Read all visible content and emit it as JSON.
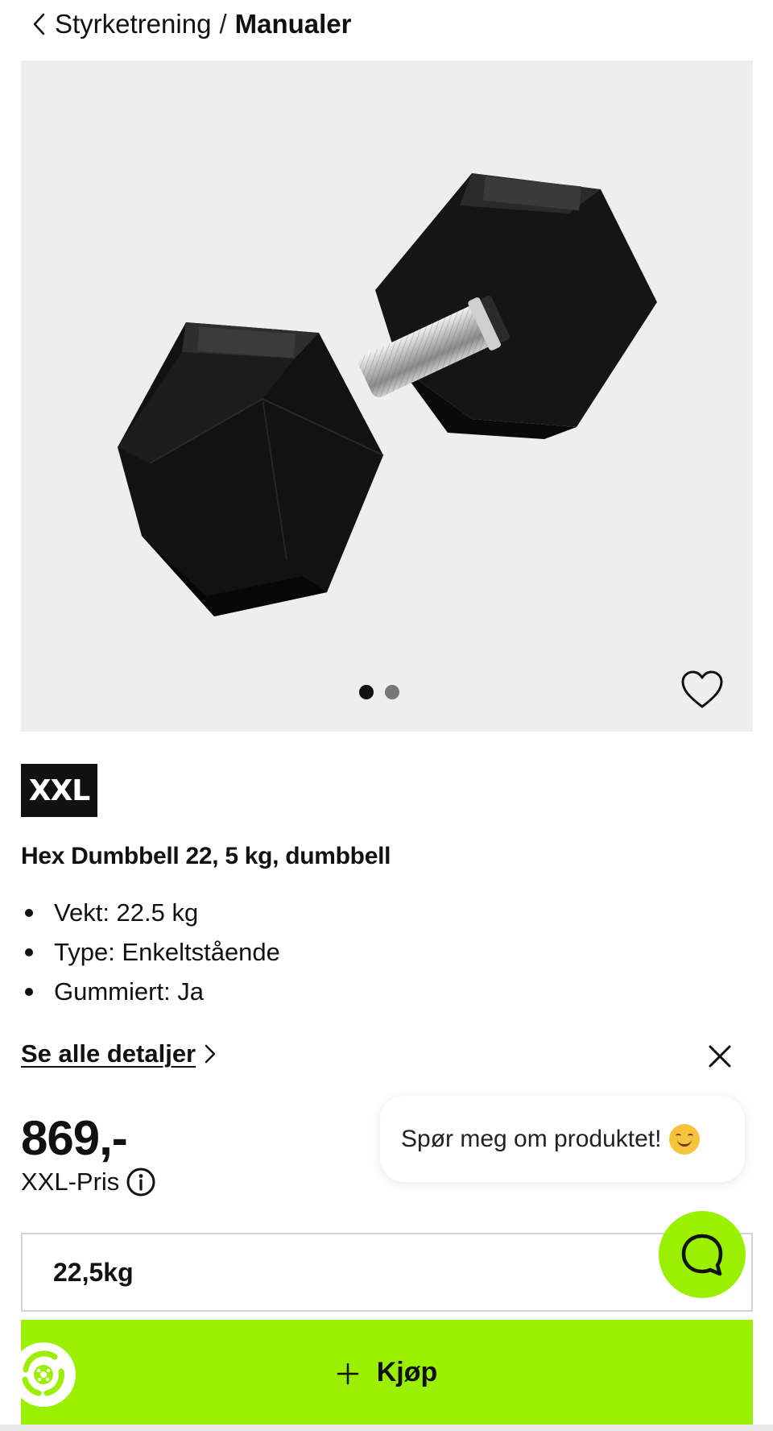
{
  "breadcrumb": {
    "parent": "Styrketrening",
    "separator": "/",
    "current": "Manualer"
  },
  "gallery": {
    "image_alt": "Hex Dumbbell",
    "slide_count": 2,
    "active_slide": 1
  },
  "brand": {
    "logo_text": "XXL"
  },
  "product": {
    "title": "Hex Dumbbell 22, 5 kg, dumbbell",
    "specs": [
      "Vekt: 22.5 kg",
      "Type: Enkeltstående",
      "Gummiert: Ja"
    ],
    "details_link": "Se alle detaljer"
  },
  "chat": {
    "prompt": "Spør meg om produktet!"
  },
  "pricing": {
    "price": "869,-",
    "label": "XXL-Pris"
  },
  "variant": {
    "selected": "22,5kg"
  },
  "actions": {
    "buy_label": "Kjøp"
  },
  "colors": {
    "accent": "#9af000",
    "hero_bg": "#eeeeee",
    "text": "#111111"
  }
}
